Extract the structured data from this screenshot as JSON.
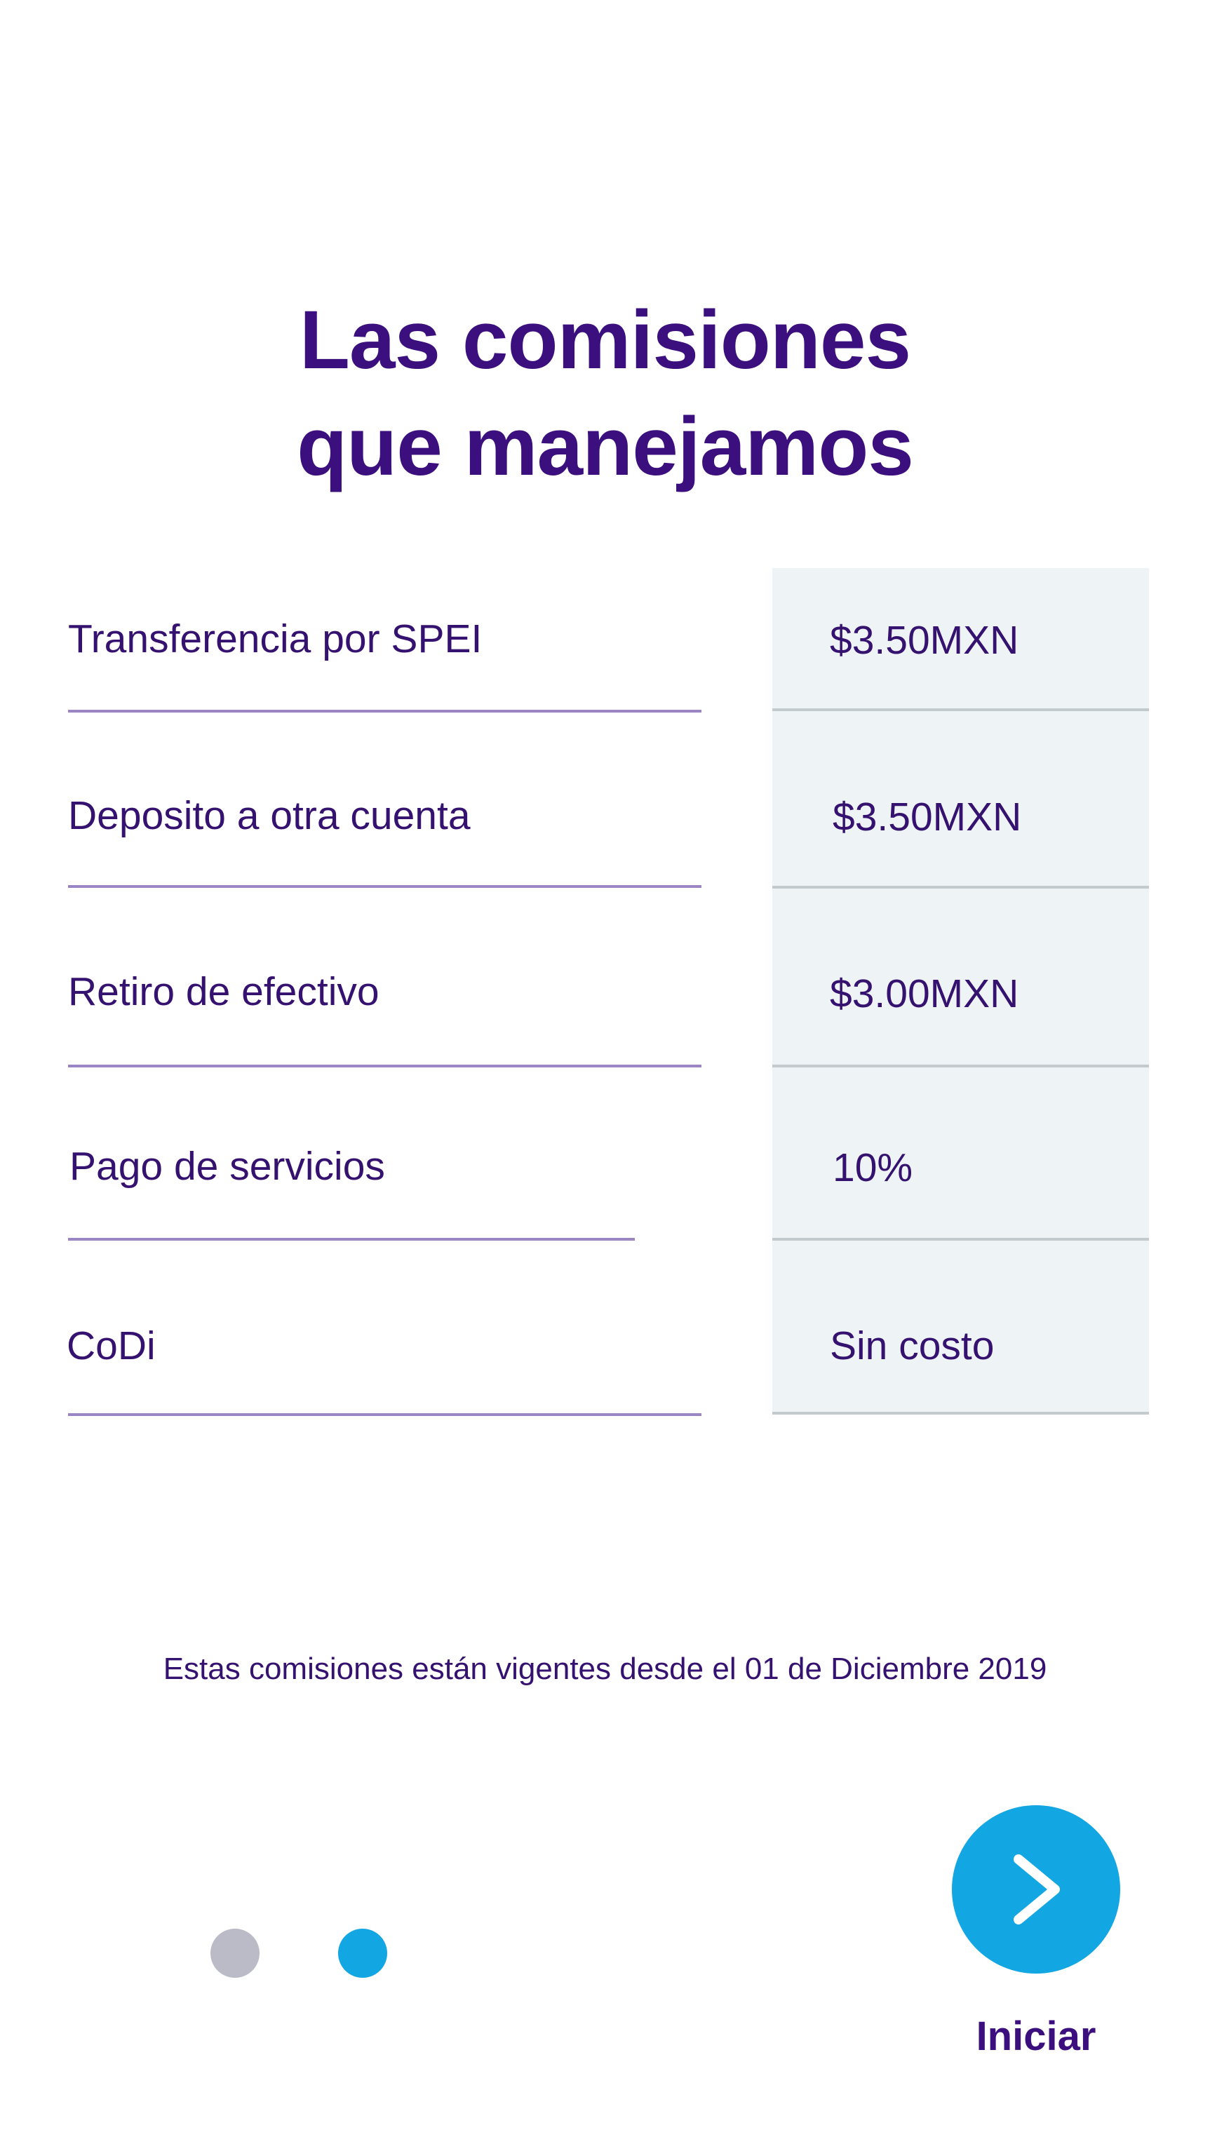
{
  "header": {
    "title_line1": "Las comisiones",
    "title_line2": "que manejamos"
  },
  "fees": {
    "rows": [
      {
        "label": "Transferencia por SPEI",
        "value": "$3.50MXN"
      },
      {
        "label": "Deposito a otra cuenta",
        "value": "$3.50MXN"
      },
      {
        "label": "Retiro de efectivo",
        "value": "$3.00MXN"
      },
      {
        "label": "Pago de servicios",
        "value": "10%"
      },
      {
        "label": "CoDi",
        "value": "Sin costo"
      }
    ]
  },
  "footnote": "Estas comisiones están vigentes desde el 01 de Diciembre 2019",
  "pager": {
    "total_pages": 2,
    "active_page": 2
  },
  "action": {
    "start_label": "Iniciar",
    "icon": "chevron-right-icon"
  },
  "colors": {
    "primary_text": "#3b0f7d",
    "accent": "#12a6e2",
    "inactive_dot": "#babbc7",
    "value_column_bg": "#eef3f5"
  }
}
